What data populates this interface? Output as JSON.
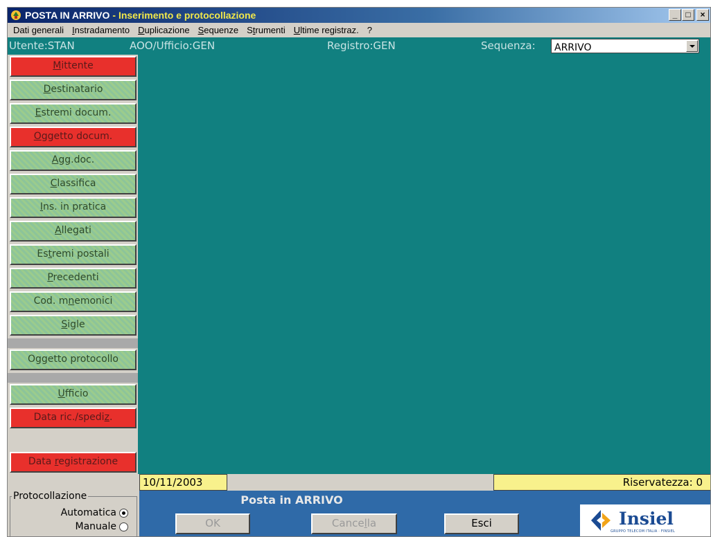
{
  "window": {
    "title": "POSTA IN ARRIVO",
    "subtitle": "- Inserimento e protocollazione",
    "minimize_label": "_",
    "maximize_label": "□",
    "close_label": "×"
  },
  "menu": {
    "items": [
      {
        "pre": "Dati generali",
        "u": "",
        "post": ""
      },
      {
        "pre": "",
        "u": "I",
        "post": "nstradamento"
      },
      {
        "pre": "",
        "u": "D",
        "post": "uplicazione"
      },
      {
        "pre": "",
        "u": "S",
        "post": "equenze"
      },
      {
        "pre": "S",
        "u": "t",
        "post": "rumenti"
      },
      {
        "pre": "",
        "u": "U",
        "post": "ltime registraz."
      },
      {
        "pre": "?",
        "u": "",
        "post": ""
      }
    ]
  },
  "info": {
    "utente": "Utente:STAN",
    "aoo": "AOO/Ufficio:GEN",
    "registro": "Registro:GEN",
    "sequenza_label": "Sequenza:",
    "sequenza_value": "ARRIVO"
  },
  "sidebar": {
    "buttons": [
      {
        "pre": "",
        "u": "M",
        "post": "ittente",
        "color": "red"
      },
      {
        "pre": "",
        "u": "D",
        "post": "estinatario",
        "color": "green"
      },
      {
        "pre": "",
        "u": "E",
        "post": "stremi docum.",
        "color": "green"
      },
      {
        "pre": "",
        "u": "O",
        "post": "ggetto docum.",
        "color": "red"
      },
      {
        "pre": "",
        "u": "A",
        "post": "gg.doc.",
        "color": "green"
      },
      {
        "pre": "",
        "u": "C",
        "post": "lassifica",
        "color": "green"
      },
      {
        "pre": "",
        "u": "I",
        "post": "ns. in pratica",
        "color": "green"
      },
      {
        "pre": "",
        "u": "A",
        "post": "llegati",
        "color": "green"
      },
      {
        "pre": "Es",
        "u": "t",
        "post": "remi postali",
        "color": "green"
      },
      {
        "pre": "",
        "u": "P",
        "post": "recedenti",
        "color": "green"
      },
      {
        "pre": "Cod. m",
        "u": "n",
        "post": "emonici",
        "color": "green"
      },
      {
        "pre": "",
        "u": "S",
        "post": "igle",
        "color": "green"
      },
      {
        "pre": "Oggetto protocollo",
        "u": "",
        "post": "",
        "color": "green"
      },
      {
        "pre": "",
        "u": "U",
        "post": "fficio",
        "color": "green"
      },
      {
        "pre": "Data ric./spedi",
        "u": "z",
        "post": ".",
        "color": "red"
      },
      {
        "pre": "Data ",
        "u": "r",
        "post": "egistrazione",
        "color": "red"
      }
    ]
  },
  "fields": {
    "data_registrazione": "10/11/2003",
    "riservatezza": "Riservatezza:  0"
  },
  "protocollazione": {
    "legend": "Protocollazione",
    "automatica_label": "Automatica",
    "manuale_label": "Manuale",
    "selected": "Automatica"
  },
  "footer": {
    "title": "Posta in ARRIVO",
    "ok_label": "OK",
    "cancella_pre": "Cance",
    "cancella_u": "l",
    "cancella_post": "la",
    "esci_label": "Esci"
  },
  "logo": {
    "text": "Insiel",
    "tagline": "GRUPPO TELECOM ITALIA · FINSIEL"
  },
  "colors": {
    "teal": "#118080",
    "button_green": "#9ccc8c",
    "button_red": "#e8302c",
    "field_yellow": "#f8f18c",
    "footer_blue": "#2f6aa8"
  }
}
